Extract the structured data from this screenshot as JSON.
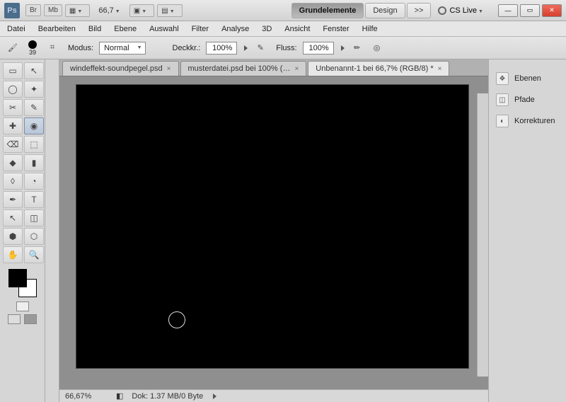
{
  "titlebar": {
    "logo": "Ps",
    "mini_btns": [
      "Br",
      "Mb"
    ],
    "zoom": "66,7",
    "workspaces": {
      "active": "Grundelemente",
      "other": "Design",
      "more": ">>"
    },
    "cslive": "CS Live",
    "window_btns": {
      "min": "—",
      "max": "▭",
      "close": "✕"
    }
  },
  "menu": [
    "Datei",
    "Bearbeiten",
    "Bild",
    "Ebene",
    "Auswahl",
    "Filter",
    "Analyse",
    "3D",
    "Ansicht",
    "Fenster",
    "Hilfe"
  ],
  "options": {
    "brush_size": "39",
    "mode_label": "Modus:",
    "mode_value": "Normal",
    "opacity_label": "Deckkr.:",
    "opacity_value": "100%",
    "flow_label": "Fluss:",
    "flow_value": "100%"
  },
  "tabs": [
    {
      "label": "windeffekt-soundpegel.psd",
      "active": false
    },
    {
      "label": "musterdatei.psd bei 100% (…",
      "active": false
    },
    {
      "label": "Unbenannt-1 bei 66,7% (RGB/8) *",
      "active": true
    }
  ],
  "status": {
    "zoom": "66,67%",
    "doc": "Dok: 1.37 MB/0 Byte"
  },
  "panels": [
    {
      "icon": "❖",
      "label": "Ebenen"
    },
    {
      "icon": "◫",
      "label": "Pfade"
    },
    {
      "icon": "◐",
      "label": "Korrekturen"
    }
  ],
  "tools": [
    "▭",
    "↖",
    "◯",
    "✦",
    "✂",
    "✎",
    "✚",
    "◉",
    "⌫",
    "⬚",
    "◆",
    "▮",
    "◊",
    "◔",
    "✒",
    "T",
    "↖",
    "◫",
    "✋",
    "🔍"
  ]
}
